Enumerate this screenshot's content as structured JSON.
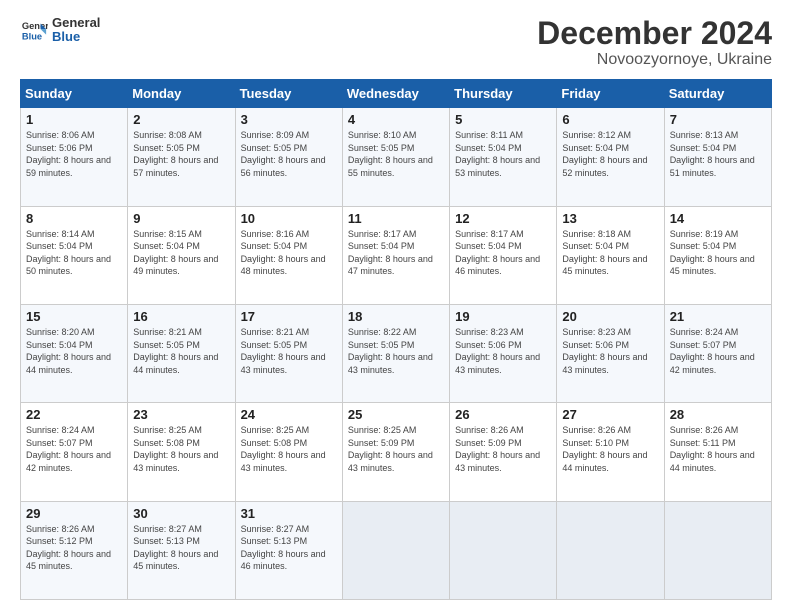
{
  "header": {
    "logo_line1": "General",
    "logo_line2": "Blue",
    "title": "December 2024",
    "subtitle": "Novoozyornoye, Ukraine"
  },
  "days_of_week": [
    "Sunday",
    "Monday",
    "Tuesday",
    "Wednesday",
    "Thursday",
    "Friday",
    "Saturday"
  ],
  "weeks": [
    [
      {
        "day": 1,
        "info": "Sunrise: 8:06 AM\nSunset: 5:06 PM\nDaylight: 8 hours and 59 minutes."
      },
      {
        "day": 2,
        "info": "Sunrise: 8:08 AM\nSunset: 5:05 PM\nDaylight: 8 hours and 57 minutes."
      },
      {
        "day": 3,
        "info": "Sunrise: 8:09 AM\nSunset: 5:05 PM\nDaylight: 8 hours and 56 minutes."
      },
      {
        "day": 4,
        "info": "Sunrise: 8:10 AM\nSunset: 5:05 PM\nDaylight: 8 hours and 55 minutes."
      },
      {
        "day": 5,
        "info": "Sunrise: 8:11 AM\nSunset: 5:04 PM\nDaylight: 8 hours and 53 minutes."
      },
      {
        "day": 6,
        "info": "Sunrise: 8:12 AM\nSunset: 5:04 PM\nDaylight: 8 hours and 52 minutes."
      },
      {
        "day": 7,
        "info": "Sunrise: 8:13 AM\nSunset: 5:04 PM\nDaylight: 8 hours and 51 minutes."
      }
    ],
    [
      {
        "day": 8,
        "info": "Sunrise: 8:14 AM\nSunset: 5:04 PM\nDaylight: 8 hours and 50 minutes."
      },
      {
        "day": 9,
        "info": "Sunrise: 8:15 AM\nSunset: 5:04 PM\nDaylight: 8 hours and 49 minutes."
      },
      {
        "day": 10,
        "info": "Sunrise: 8:16 AM\nSunset: 5:04 PM\nDaylight: 8 hours and 48 minutes."
      },
      {
        "day": 11,
        "info": "Sunrise: 8:17 AM\nSunset: 5:04 PM\nDaylight: 8 hours and 47 minutes."
      },
      {
        "day": 12,
        "info": "Sunrise: 8:17 AM\nSunset: 5:04 PM\nDaylight: 8 hours and 46 minutes."
      },
      {
        "day": 13,
        "info": "Sunrise: 8:18 AM\nSunset: 5:04 PM\nDaylight: 8 hours and 45 minutes."
      },
      {
        "day": 14,
        "info": "Sunrise: 8:19 AM\nSunset: 5:04 PM\nDaylight: 8 hours and 45 minutes."
      }
    ],
    [
      {
        "day": 15,
        "info": "Sunrise: 8:20 AM\nSunset: 5:04 PM\nDaylight: 8 hours and 44 minutes."
      },
      {
        "day": 16,
        "info": "Sunrise: 8:21 AM\nSunset: 5:05 PM\nDaylight: 8 hours and 44 minutes."
      },
      {
        "day": 17,
        "info": "Sunrise: 8:21 AM\nSunset: 5:05 PM\nDaylight: 8 hours and 43 minutes."
      },
      {
        "day": 18,
        "info": "Sunrise: 8:22 AM\nSunset: 5:05 PM\nDaylight: 8 hours and 43 minutes."
      },
      {
        "day": 19,
        "info": "Sunrise: 8:23 AM\nSunset: 5:06 PM\nDaylight: 8 hours and 43 minutes."
      },
      {
        "day": 20,
        "info": "Sunrise: 8:23 AM\nSunset: 5:06 PM\nDaylight: 8 hours and 43 minutes."
      },
      {
        "day": 21,
        "info": "Sunrise: 8:24 AM\nSunset: 5:07 PM\nDaylight: 8 hours and 42 minutes."
      }
    ],
    [
      {
        "day": 22,
        "info": "Sunrise: 8:24 AM\nSunset: 5:07 PM\nDaylight: 8 hours and 42 minutes."
      },
      {
        "day": 23,
        "info": "Sunrise: 8:25 AM\nSunset: 5:08 PM\nDaylight: 8 hours and 43 minutes."
      },
      {
        "day": 24,
        "info": "Sunrise: 8:25 AM\nSunset: 5:08 PM\nDaylight: 8 hours and 43 minutes."
      },
      {
        "day": 25,
        "info": "Sunrise: 8:25 AM\nSunset: 5:09 PM\nDaylight: 8 hours and 43 minutes."
      },
      {
        "day": 26,
        "info": "Sunrise: 8:26 AM\nSunset: 5:09 PM\nDaylight: 8 hours and 43 minutes."
      },
      {
        "day": 27,
        "info": "Sunrise: 8:26 AM\nSunset: 5:10 PM\nDaylight: 8 hours and 44 minutes."
      },
      {
        "day": 28,
        "info": "Sunrise: 8:26 AM\nSunset: 5:11 PM\nDaylight: 8 hours and 44 minutes."
      }
    ],
    [
      {
        "day": 29,
        "info": "Sunrise: 8:26 AM\nSunset: 5:12 PM\nDaylight: 8 hours and 45 minutes."
      },
      {
        "day": 30,
        "info": "Sunrise: 8:27 AM\nSunset: 5:13 PM\nDaylight: 8 hours and 45 minutes."
      },
      {
        "day": 31,
        "info": "Sunrise: 8:27 AM\nSunset: 5:13 PM\nDaylight: 8 hours and 46 minutes."
      },
      null,
      null,
      null,
      null
    ]
  ]
}
